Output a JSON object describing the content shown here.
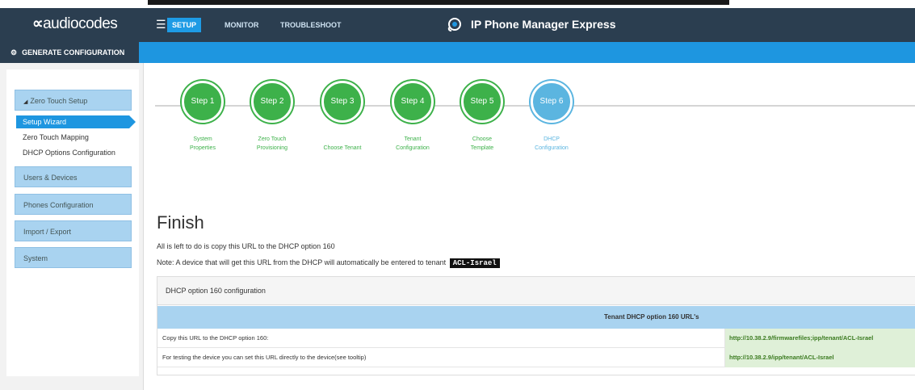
{
  "brand": {
    "logo_mark": "∝",
    "logo_text": "audiocodes"
  },
  "topnav": {
    "items": [
      {
        "label": "SETUP",
        "active": true
      },
      {
        "label": "MONITOR",
        "active": false
      },
      {
        "label": "TROUBLESHOOT",
        "active": false
      }
    ],
    "app_title": "IP Phone Manager Express"
  },
  "subheader": {
    "label": "GENERATE CONFIGURATION"
  },
  "sidebar": {
    "sections": [
      {
        "label": "Zero Touch Setup",
        "expanded": true,
        "children": [
          "Setup Wizard",
          "Zero Touch Mapping",
          "DHCP Options Configuration"
        ],
        "active_child": "Setup Wizard"
      },
      {
        "label": "Users & Devices"
      },
      {
        "label": "Phones Configuration"
      },
      {
        "label": "Import / Export"
      },
      {
        "label": "System"
      }
    ]
  },
  "steps": [
    {
      "label": "Step 1",
      "caption": [
        "System",
        "Properties"
      ]
    },
    {
      "label": "Step 2",
      "caption": [
        "Zero Touch",
        "Provisioning"
      ]
    },
    {
      "label": "Step 3",
      "caption": [
        "Choose Tenant"
      ]
    },
    {
      "label": "Step 4",
      "caption": [
        "Tenant",
        "Configuration"
      ]
    },
    {
      "label": "Step 5",
      "caption": [
        "Choose",
        "Template"
      ]
    },
    {
      "label": "Step 6",
      "caption": [
        "DHCP",
        "Configuration"
      ],
      "current": true
    }
  ],
  "finish": {
    "title": "Finish",
    "line1": "All is left to do is copy this URL to the DHCP option 160",
    "line2": "Note: A device that will get this URL from the DHCP will automatically be entered to tenant",
    "tenant": "ACL-Israel"
  },
  "panel": {
    "heading": "DHCP option 160 configuration",
    "table_header": "Tenant DHCP option 160 URL's",
    "rows": [
      {
        "label": "Copy this URL to the DHCP option 160:",
        "url": "http://10.38.2.9/firmwarefiles;ipp/tenant/ACL-Israel"
      },
      {
        "label": "For testing the device you can set this URL directly to the device(see tooltip)",
        "url": "http://10.38.2.9/ipp/tenant/ACL-Israel"
      }
    ]
  },
  "colors": {
    "topbar": "#2b3e50",
    "accent": "#1e96e0",
    "step_done": "#3db14a",
    "step_current": "#5bb5e0",
    "sidebar_item": "#a9d3f0",
    "url_cell": "#dff0d8"
  },
  "icons": {
    "menu": "hamburger-menu-icon",
    "app": "phone-gear-icon",
    "gear": "gear-icon",
    "expand": "triangle-down-icon"
  }
}
